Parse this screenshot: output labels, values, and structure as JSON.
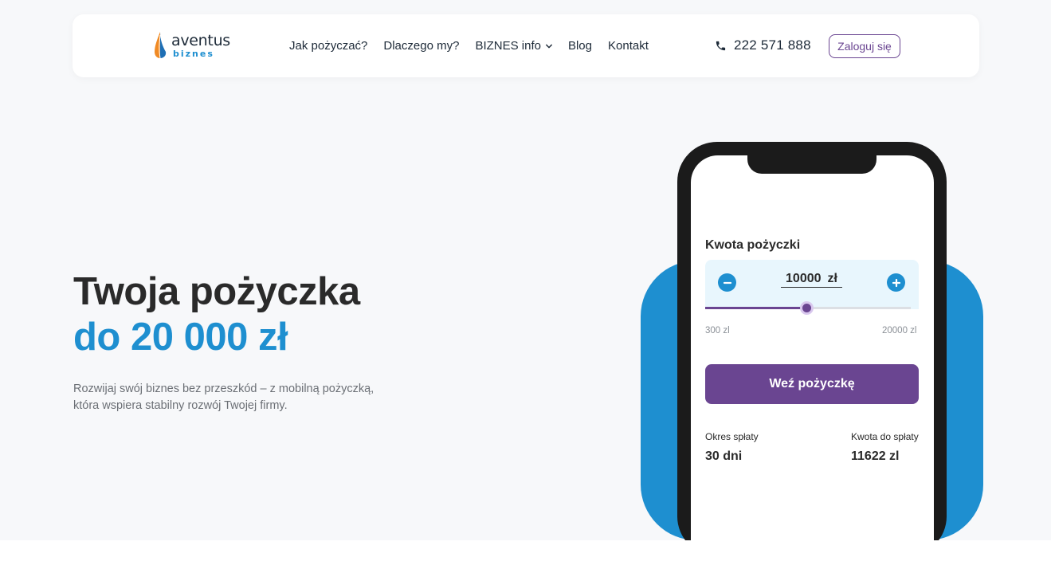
{
  "header": {
    "logo": {
      "word": "aventus",
      "sub": "biznes"
    },
    "nav": [
      {
        "label": "Jak pożyczać?"
      },
      {
        "label": "Dlaczego my?"
      },
      {
        "label": "BIZNES info",
        "has_dropdown": true
      },
      {
        "label": "Blog"
      },
      {
        "label": "Kontakt"
      }
    ],
    "phone": "222 571 888",
    "login_label": "Zaloguj się"
  },
  "hero": {
    "title_line1": "Twoja pożyczka",
    "title_line2": "do 20 000 zł",
    "description_line1": "Rozwijaj swój biznes bez przeszkód – z mobilną pożyczką,",
    "description_line2": "która wspiera stabilny rozwój Twojej firmy."
  },
  "calculator": {
    "title": "Kwota pożyczki",
    "amount": "10000",
    "currency": "zł",
    "min_label": "300 zl",
    "max_label": "20000 zl",
    "min_value": 300,
    "max_value": 20000,
    "value": 10000,
    "cta_label": "Weź pożyczkę",
    "term_label": "Okres spłaty",
    "term_value": "30 dni",
    "repay_label": "Kwota do spłaty",
    "repay_value": "11622 zl"
  },
  "colors": {
    "brand_blue": "#1e8fd0",
    "brand_purple": "#6a4591",
    "text_dark": "#2a2a2a"
  },
  "icons": {
    "phone": "phone-icon",
    "minus": "minus-icon",
    "plus": "plus-icon",
    "chevron": "chevron-down-icon"
  }
}
